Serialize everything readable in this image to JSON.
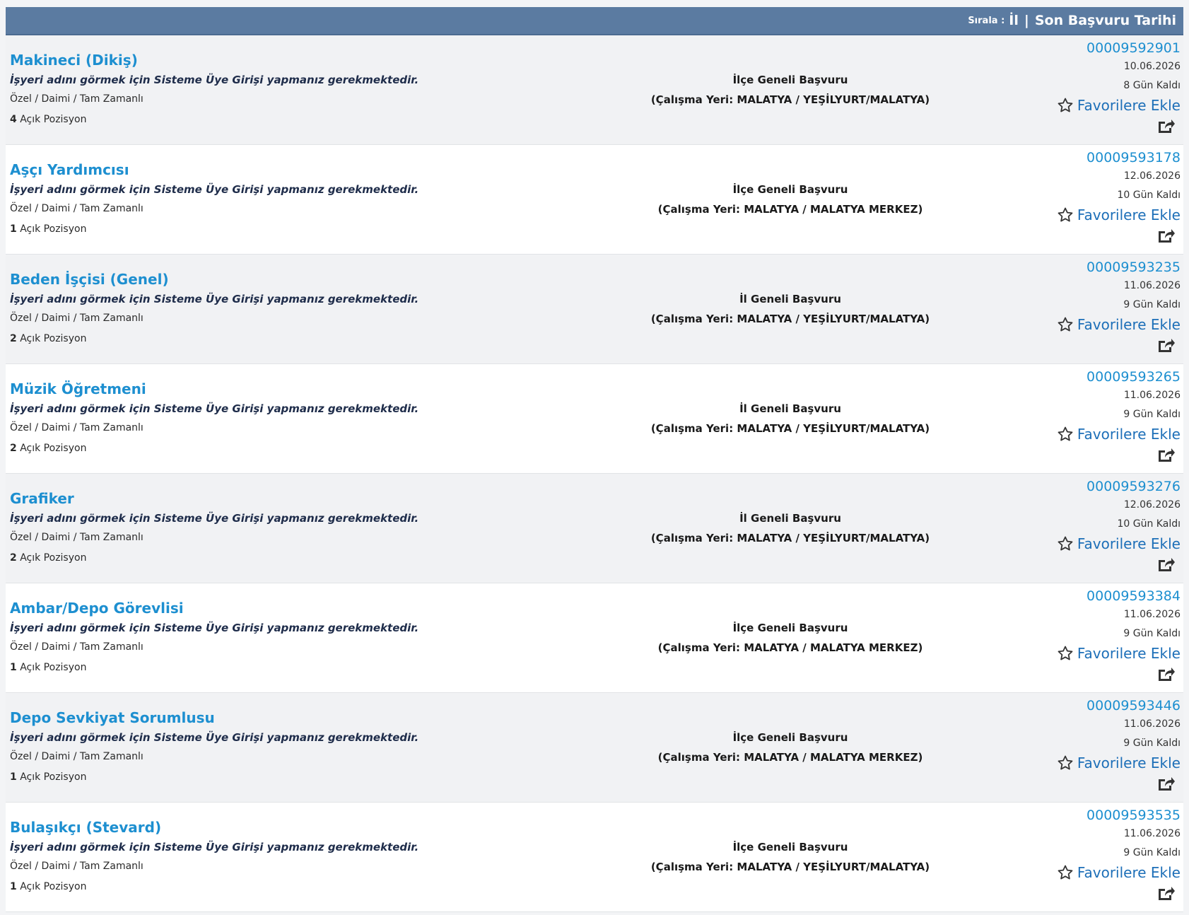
{
  "header": {
    "sort_label": "Sırala :",
    "sort_options": [
      "İl",
      "Son Başvuru Tarihi"
    ],
    "separator": "|",
    "background": "#5b7ba1"
  },
  "common": {
    "notice": "İşyeri adını görmek için Sisteme Üye Girişi yapmanız gerekmektedir.",
    "positions_suffix": "Açık Pozisyon",
    "favorite_label": "Favorilere Ekle",
    "favorite_icon": "star-outline-icon",
    "share_icon": "share-icon",
    "accent_color": "#1d8fd0"
  },
  "jobs": [
    {
      "title": "Makineci (Dikiş)",
      "type": "Özel / Daimi / Tam Zamanlı",
      "positions": "4",
      "scope": "İlçe Geneli Başvuru",
      "location": "(Çalışma Yeri: MALATYA / YEŞİLYURT/MALATYA)",
      "job_no": "00009592901",
      "date": "10.06.2026",
      "days_left": "8 Gün Kaldı"
    },
    {
      "title": "Aşçı Yardımcısı",
      "type": "Özel / Daimi / Tam Zamanlı",
      "positions": "1",
      "scope": "İlçe Geneli Başvuru",
      "location": "(Çalışma Yeri: MALATYA / MALATYA MERKEZ)",
      "job_no": "00009593178",
      "date": "12.06.2026",
      "days_left": "10 Gün Kaldı"
    },
    {
      "title": "Beden İşçisi (Genel)",
      "type": "Özel / Daimi / Tam Zamanlı",
      "positions": "2",
      "scope": "İl Geneli Başvuru",
      "location": "(Çalışma Yeri: MALATYA / YEŞİLYURT/MALATYA)",
      "job_no": "00009593235",
      "date": "11.06.2026",
      "days_left": "9 Gün Kaldı"
    },
    {
      "title": "Müzik Öğretmeni",
      "type": "Özel / Daimi / Tam Zamanlı",
      "positions": "2",
      "scope": "İl Geneli Başvuru",
      "location": "(Çalışma Yeri: MALATYA / YEŞİLYURT/MALATYA)",
      "job_no": "00009593265",
      "date": "11.06.2026",
      "days_left": "9 Gün Kaldı"
    },
    {
      "title": "Grafiker",
      "type": "Özel / Daimi / Tam Zamanlı",
      "positions": "2",
      "scope": "İl Geneli Başvuru",
      "location": "(Çalışma Yeri: MALATYA / YEŞİLYURT/MALATYA)",
      "job_no": "00009593276",
      "date": "12.06.2026",
      "days_left": "10 Gün Kaldı"
    },
    {
      "title": "Ambar/Depo Görevlisi",
      "type": "Özel / Daimi / Tam Zamanlı",
      "positions": "1",
      "scope": "İlçe Geneli Başvuru",
      "location": "(Çalışma Yeri: MALATYA / MALATYA MERKEZ)",
      "job_no": "00009593384",
      "date": "11.06.2026",
      "days_left": "9 Gün Kaldı"
    },
    {
      "title": "Depo Sevkiyat Sorumlusu",
      "type": "Özel / Daimi / Tam Zamanlı",
      "positions": "1",
      "scope": "İlçe Geneli Başvuru",
      "location": "(Çalışma Yeri: MALATYA / MALATYA MERKEZ)",
      "job_no": "00009593446",
      "date": "11.06.2026",
      "days_left": "9 Gün Kaldı"
    },
    {
      "title": "Bulaşıkçı (Stevard)",
      "type": "Özel / Daimi / Tam Zamanlı",
      "positions": "1",
      "scope": "İlçe Geneli Başvuru",
      "location": "(Çalışma Yeri: MALATYA / YEŞİLYURT/MALATYA)",
      "job_no": "00009593535",
      "date": "11.06.2026",
      "days_left": "9 Gün Kaldı"
    }
  ]
}
